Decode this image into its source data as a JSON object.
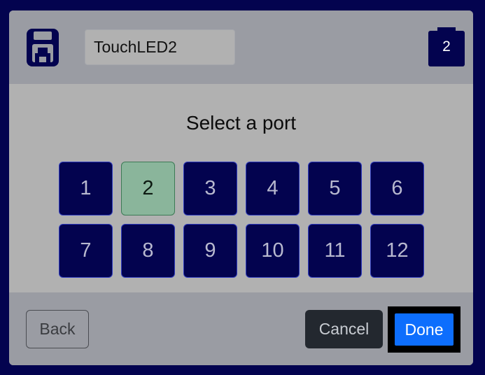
{
  "header": {
    "device_icon": "device-save-icon",
    "device_name_value": "TouchLED2",
    "selected_port_badge": "2"
  },
  "body": {
    "title": "Select a port",
    "ports": [
      "1",
      "2",
      "3",
      "4",
      "5",
      "6",
      "7",
      "8",
      "9",
      "10",
      "11",
      "12"
    ],
    "selected_port": "2"
  },
  "footer": {
    "back_label": "Back",
    "cancel_label": "Cancel",
    "done_label": "Done"
  },
  "colors": {
    "background": "#03034f",
    "port_default": "#03034f",
    "port_selected": "#8ab59b",
    "done_button": "#0d6efd",
    "cancel_button": "#23282f"
  }
}
